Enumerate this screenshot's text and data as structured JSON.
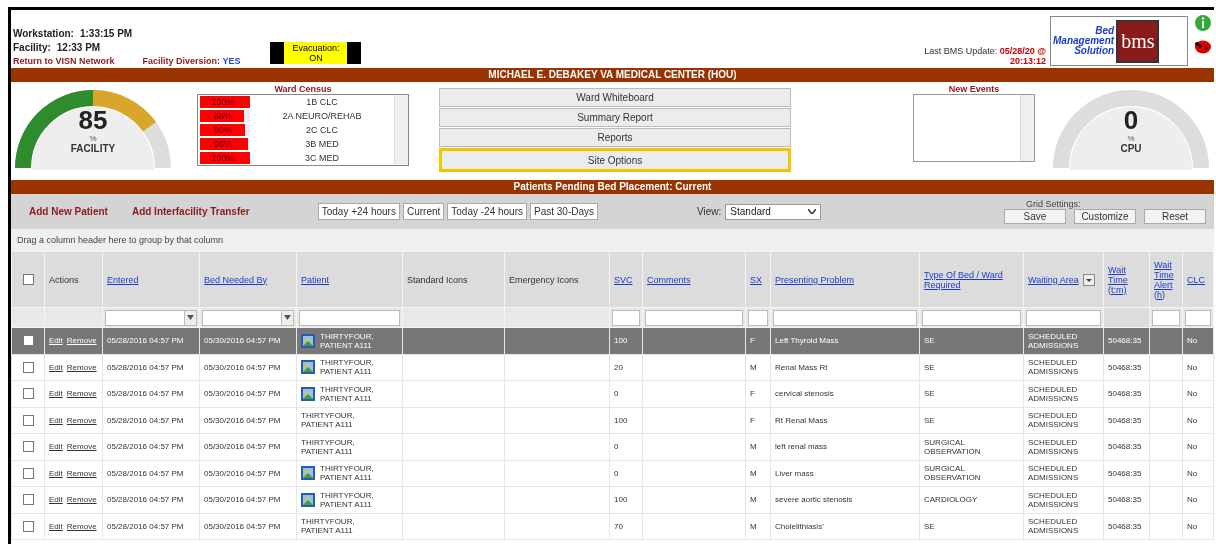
{
  "header": {
    "workstation_label": "Workstation:",
    "workstation_time": "1:33:15 PM",
    "facility_label": "Facility:",
    "facility_time": "12:33 PM",
    "return_link": "Return to VISN Network",
    "diversion_label": "Facility Diversion:",
    "diversion_value": "YES",
    "evacuation_label": "Evacuation:",
    "evacuation_value": "ON",
    "update_label": "Last BMS Update:",
    "update_value": "05/28/20 @ 20:13:12",
    "logo_text": [
      "Bed",
      "Management",
      "Solution"
    ],
    "logo_mark": "bms"
  },
  "title_bar": "MICHAEL E. DEBAKEY VA MEDICAL CENTER (HOU)",
  "facility_gauge": {
    "value": "85",
    "unit": "%",
    "label": "FACILITY"
  },
  "ward_census": {
    "title": "Ward Census",
    "wards": [
      {
        "pct": "100%",
        "name": "1B CLC",
        "level": 1.0
      },
      {
        "pct": "88%",
        "name": "2A NEURO/REHAB",
        "level": 0.88
      },
      {
        "pct": "90%",
        "name": "2C CLC",
        "level": 0.9
      },
      {
        "pct": "96%",
        "name": "3B MED",
        "level": 0.96
      },
      {
        "pct": "100%",
        "name": "3C MED",
        "level": 1.0
      }
    ]
  },
  "menu_buttons": [
    {
      "label": "Ward Whiteboard",
      "selected": false
    },
    {
      "label": "Summary Report",
      "selected": false
    },
    {
      "label": "Reports",
      "selected": false
    },
    {
      "label": "Site Options",
      "selected": true
    }
  ],
  "new_events": {
    "title": "New Events"
  },
  "cpu_gauge": {
    "value": "0",
    "unit": "%",
    "label": "CPU"
  },
  "section_bar": "Patients Pending Bed Placement: Current",
  "toolbar": {
    "links": [
      "Add New Patient",
      "Add Interfacility Transfer"
    ],
    "time_filters": [
      "Today +24 hours",
      "Current",
      "Today -24 hours",
      "Past 30-Days"
    ],
    "view_label": "View:",
    "view_value": "Standard",
    "grid_label": "Grid Settings:",
    "grid_buttons": [
      "Save",
      "Customize",
      "Reset"
    ]
  },
  "group_hint": "Drag a column header here to group by that column",
  "table": {
    "columns": [
      {
        "kind": "checkbox",
        "checked": false
      },
      {
        "kind": "plain",
        "label": "Actions"
      },
      {
        "kind": "link",
        "label": "Entered"
      },
      {
        "kind": "link",
        "label": "Bed Needed By"
      },
      {
        "kind": "link",
        "label": "Patient"
      },
      {
        "kind": "plain",
        "label": "Standard Icons"
      },
      {
        "kind": "plain",
        "label": "Emergency Icons"
      },
      {
        "kind": "link",
        "label": "SVC"
      },
      {
        "kind": "link",
        "label": "Comments"
      },
      {
        "kind": "link",
        "label": "SX"
      },
      {
        "kind": "link",
        "label": "Presenting Problem"
      },
      {
        "kind": "link",
        "label": "Type Of Bed / Ward Required"
      },
      {
        "kind": "menu",
        "label": "Waiting Area"
      },
      {
        "kind": "link",
        "label": "Wait Time (t:m)"
      },
      {
        "kind": "link",
        "label": "Wait Time Alert (h)"
      },
      {
        "kind": "link",
        "label": "CLC"
      }
    ],
    "filter_row": [
      {
        "kind": "none"
      },
      {
        "kind": "none"
      },
      {
        "kind": "dropdown"
      },
      {
        "kind": "dropdown"
      },
      {
        "kind": "text"
      },
      {
        "kind": "none"
      },
      {
        "kind": "none"
      },
      {
        "kind": "text"
      },
      {
        "kind": "text"
      },
      {
        "kind": "text"
      },
      {
        "kind": "text"
      },
      {
        "kind": "text"
      },
      {
        "kind": "text"
      },
      {
        "kind": "shaded"
      },
      {
        "kind": "text"
      },
      {
        "kind": "text"
      }
    ],
    "rows": [
      {
        "selected": true,
        "checked": false,
        "edit": "Edit",
        "remove": "Remove",
        "entered": "05/28/2016 04:57 PM",
        "needed": "05/30/2016 04:57 PM",
        "photo": true,
        "patient": "THIRTYFOUR, PATIENT A111",
        "svc": "100",
        "sx": "F",
        "problem": "Left Thyroid Mass",
        "bed": "SE",
        "waiting": "SCHEDULED ADMISSIONS",
        "wait": "50468:35",
        "clc": "No"
      },
      {
        "selected": false,
        "checked": false,
        "edit": "Edit",
        "remove": "Remove",
        "entered": "05/28/2016 04:57 PM",
        "needed": "05/30/2016 04:57 PM",
        "photo": true,
        "patient": "THIRTYFOUR, PATIENT A111",
        "svc": "20",
        "sx": "M",
        "problem": "Renal Mass Rt",
        "bed": "SE",
        "waiting": "SCHEDULED ADMISSIONS",
        "wait": "50468:35",
        "clc": "No"
      },
      {
        "selected": false,
        "checked": false,
        "edit": "Edit",
        "remove": "Remove",
        "entered": "05/28/2016 04:57 PM",
        "needed": "05/30/2016 04:57 PM",
        "photo": true,
        "patient": "THIRTYFOUR, PATIENT A111",
        "svc": "0",
        "sx": "F",
        "problem": "cervical stenosis",
        "bed": "SE",
        "waiting": "SCHEDULED ADMISSIONS",
        "wait": "50468:35",
        "clc": "No"
      },
      {
        "selected": false,
        "checked": false,
        "edit": "Edit",
        "remove": "Remove",
        "entered": "05/28/2016 04:57 PM",
        "needed": "05/30/2016 04:57 PM",
        "photo": false,
        "patient": "THIRTYFOUR, PATIENT A111",
        "svc": "100",
        "sx": "F",
        "problem": "Rt Renal Mass",
        "bed": "SE",
        "waiting": "SCHEDULED ADMISSIONS",
        "wait": "50468:35",
        "clc": "No"
      },
      {
        "selected": false,
        "checked": false,
        "edit": "Edit",
        "remove": "Remove",
        "entered": "05/28/2016 04:57 PM",
        "needed": "05/30/2016 04:57 PM",
        "photo": false,
        "patient": "THIRTYFOUR, PATIENT A111",
        "svc": "0",
        "sx": "M",
        "problem": "left renal mass",
        "bed": "SURGICAL OBSERVATION",
        "waiting": "SCHEDULED ADMISSIONS",
        "wait": "50468:35",
        "clc": "No"
      },
      {
        "selected": false,
        "checked": false,
        "edit": "Edit",
        "remove": "Remove",
        "entered": "05/28/2016 04:57 PM",
        "needed": "05/30/2016 04:57 PM",
        "photo": true,
        "patient": "THIRTYFOUR, PATIENT A111",
        "svc": "0",
        "sx": "M",
        "problem": "Liver mass",
        "bed": "SURGICAL OBSERVATION",
        "waiting": "SCHEDULED ADMISSIONS",
        "wait": "50468:35",
        "clc": "No"
      },
      {
        "selected": false,
        "checked": false,
        "edit": "Edit",
        "remove": "Remove",
        "entered": "05/28/2016 04:57 PM",
        "needed": "05/30/2016 04:57 PM",
        "photo": true,
        "patient": "THIRTYFOUR, PATIENT A111",
        "svc": "100",
        "sx": "M",
        "problem": "severe aortic stenosis",
        "bed": "CARDIOLOGY",
        "waiting": "SCHEDULED ADMISSIONS",
        "wait": "50468:35",
        "clc": "No"
      },
      {
        "selected": false,
        "checked": false,
        "edit": "Edit",
        "remove": "Remove",
        "entered": "05/28/2016 04:57 PM",
        "needed": "05/30/2016 04:57 PM",
        "photo": false,
        "patient": "THIRTYFOUR, PATIENT A111",
        "svc": "70",
        "sx": "M",
        "problem": "Cholelithiasis'",
        "bed": "SE",
        "waiting": "SCHEDULED ADMISSIONS",
        "wait": "50468:35",
        "clc": "No"
      }
    ]
  }
}
